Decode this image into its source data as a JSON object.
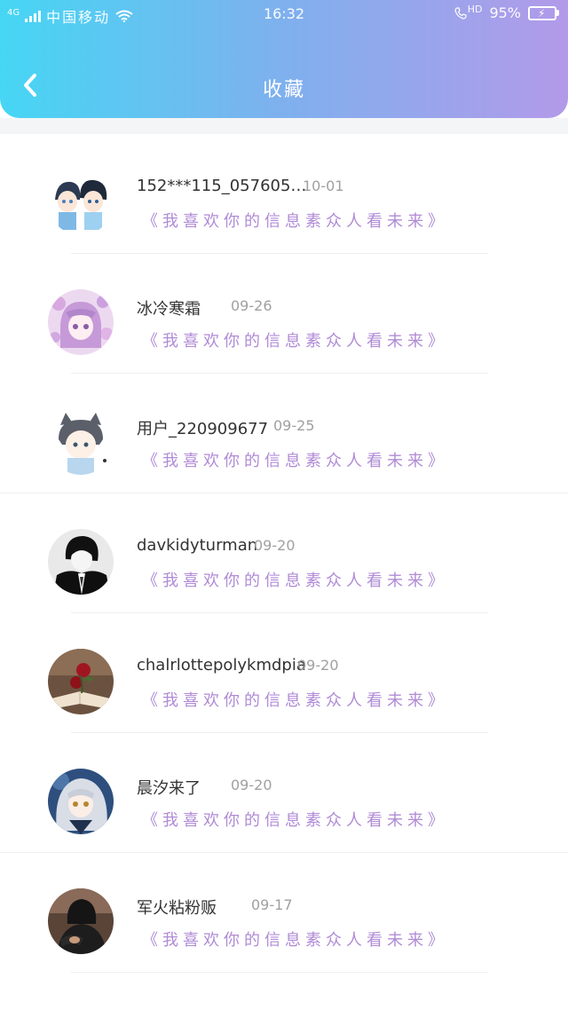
{
  "status_bar": {
    "network": "4G",
    "carrier": "中国移动",
    "time": "16:32",
    "call_icon": "hd-call-icon",
    "hd": "HD",
    "battery": "95%"
  },
  "header": {
    "back_icon": "chevron-left-icon",
    "title": "收藏"
  },
  "colors": {
    "header_gradient_start": "#46d6f4",
    "header_gradient_end": "#b29ae9",
    "quote_color": "#b08bd6",
    "battery_fill": "#35e07a"
  },
  "favorites": [
    {
      "name": "152***115_057605…",
      "date": "10-01",
      "quote": "《我喜欢你的信息素众人看未来》",
      "avatar": "anime-boys-avatar"
    },
    {
      "name": "冰冷寒霜",
      "date": "09-26",
      "quote": "《我喜欢你的信息素众人看未来》",
      "avatar": "anime-girl-purple-avatar"
    },
    {
      "name": "用户_220909677",
      "date": "09-25",
      "quote": "《我喜欢你的信息素众人看未来》",
      "avatar": "cat-ear-boy-avatar"
    },
    {
      "name": "davkidyturman",
      "date": "09-20",
      "quote": "《我喜欢你的信息素众人看未来》",
      "avatar": "suit-man-avatar"
    },
    {
      "name": "chalrlottepolykmdpia",
      "date": "09-20",
      "quote": "《我喜欢你的信息素众人看未来》",
      "avatar": "rose-book-avatar"
    },
    {
      "name": "晨汐来了",
      "date": "09-20",
      "quote": "《我喜欢你的信息素众人看未来》",
      "avatar": "silver-hair-girl-avatar"
    },
    {
      "name": "军火粘粉贩",
      "date": "09-17",
      "quote": "《我喜欢你的信息素众人看未来》",
      "avatar": "dark-figure-avatar"
    }
  ]
}
